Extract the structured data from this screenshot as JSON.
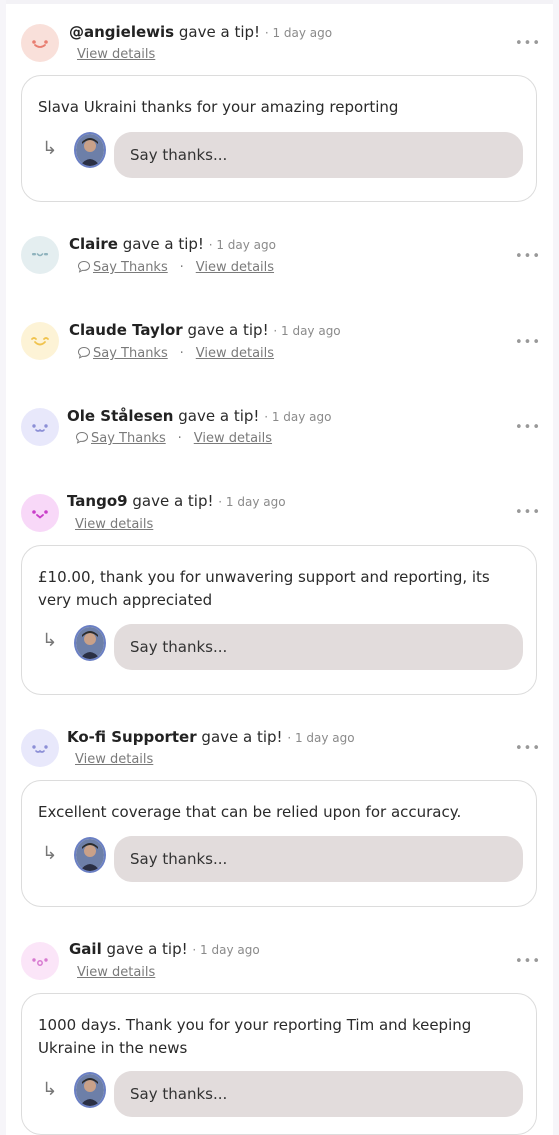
{
  "tips": [
    {
      "name": "@angielewis",
      "action": "gave a tip!",
      "time": "· 1 day ago",
      "view": "View details",
      "message": "Slava Ukraini thanks for your amazing reporting",
      "reply_placeholder": "Say thanks...",
      "avatar_color": "#f9e0da",
      "face_color": "#e87d70"
    },
    {
      "name": "Claire",
      "action": "gave a tip!",
      "time": "· 1 day ago",
      "say_thanks": "Say Thanks",
      "view": "View details",
      "avatar_color": "#e4eef0",
      "face_color": "#8fb3bd"
    },
    {
      "name": "Claude Taylor",
      "action": "gave a tip!",
      "time": "· 1 day ago",
      "say_thanks": "Say Thanks",
      "view": "View details",
      "avatar_color": "#fdf3d6",
      "face_color": "#f0c34e"
    },
    {
      "name": "Ole Stålesen",
      "action": "gave a tip!",
      "time": "· 1 day ago",
      "say_thanks": "Say Thanks",
      "view": "View details",
      "avatar_color": "#e8e8fb",
      "face_color": "#8c8fd6"
    },
    {
      "name": "Tango9",
      "action": "gave a tip!",
      "time": "· 1 day ago",
      "view": "View details",
      "message": "£10.00, thank you for unwavering support and reporting, its very much appreciated",
      "reply_placeholder": "Say thanks...",
      "avatar_color": "#f8d8f8",
      "face_color": "#c93ec9"
    },
    {
      "name": "Ko-fi Supporter",
      "action": "gave a tip!",
      "time": "· 1 day ago",
      "view": "View details",
      "message": "Excellent coverage that can be relied upon for accuracy.",
      "reply_placeholder": "Say thanks...",
      "avatar_color": "#e8e8fb",
      "face_color": "#8c8fd6"
    },
    {
      "name": "Gail",
      "action": "gave a tip!",
      "time": "· 1 day ago",
      "view": "View details",
      "message": "1000 days. Thank you for your reporting Tim and keeping Ukraine in the news",
      "reply_placeholder": "Say thanks...",
      "avatar_color": "#fbe5f8",
      "face_color": "#d77ad0"
    }
  ],
  "more_label": "•••",
  "dot_sep": "·",
  "reply_arrow": "↳"
}
